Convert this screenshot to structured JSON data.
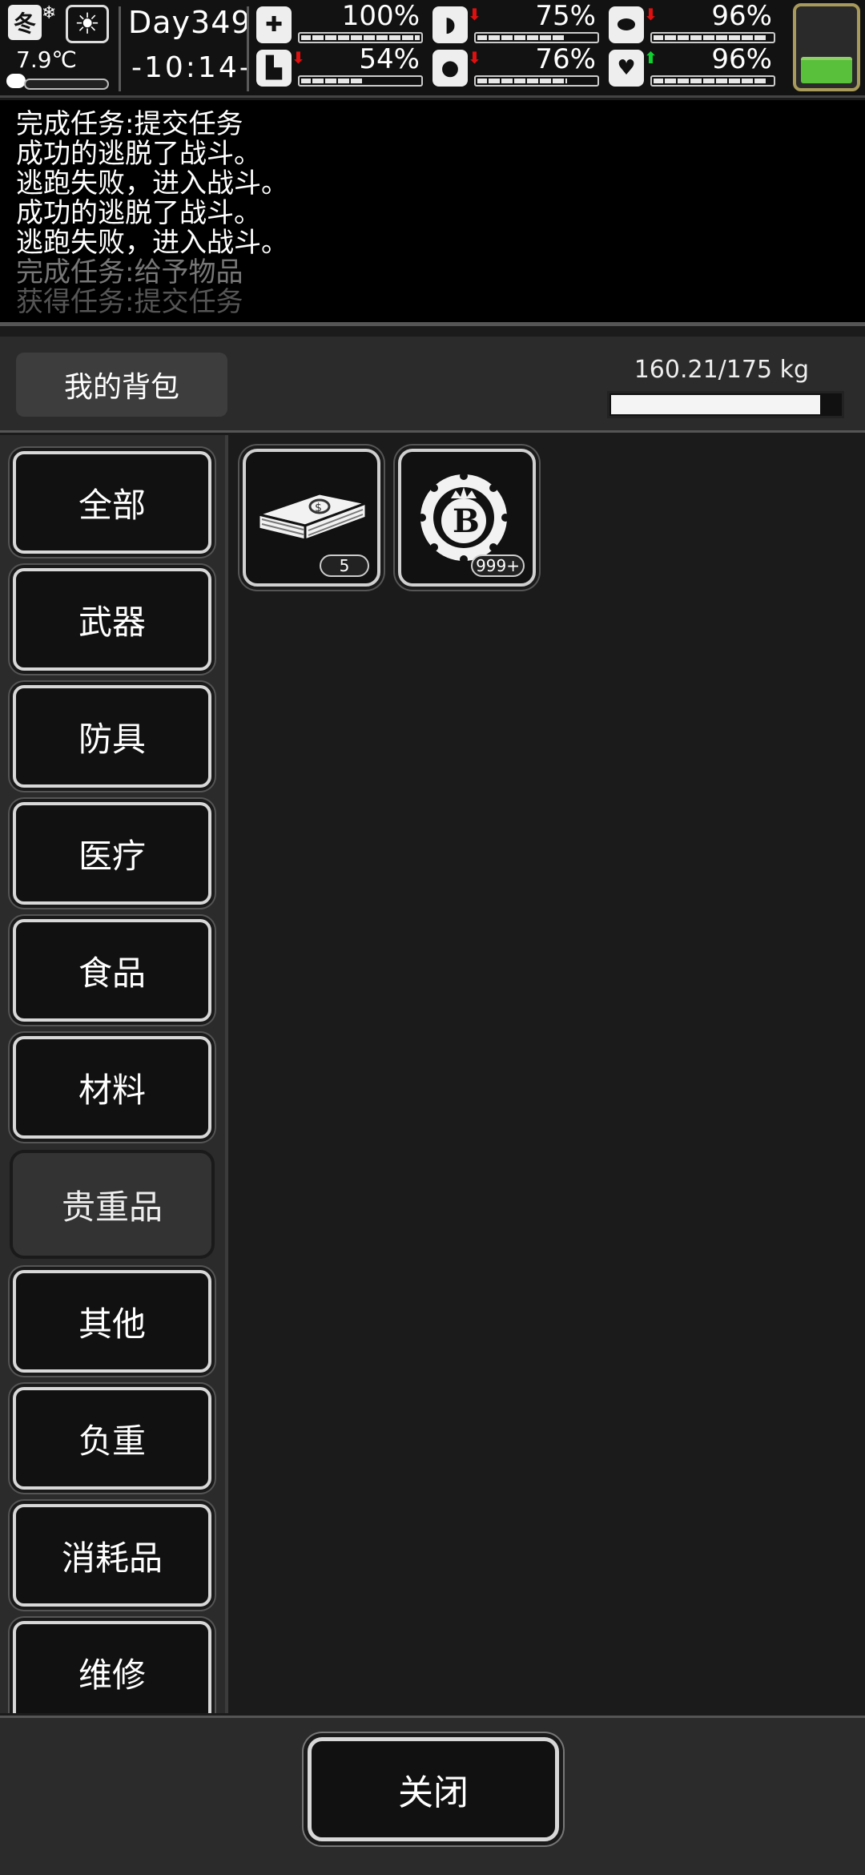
{
  "hud": {
    "season": "冬",
    "temperature": "7.9℃",
    "day": "Day349",
    "time": "-10:14-",
    "stats": [
      {
        "name": "health",
        "icon": "medkit-icon",
        "value": "100%",
        "level": 1.0,
        "trend": ""
      },
      {
        "name": "hunger",
        "icon": "stomach-icon",
        "value": "75%",
        "level": 0.75,
        "trend": "down"
      },
      {
        "name": "medicine",
        "icon": "pill-icon",
        "value": "96%",
        "level": 0.96,
        "trend": "down"
      },
      {
        "name": "stamina",
        "icon": "foot-icon",
        "value": "54%",
        "level": 0.54,
        "trend": "down"
      },
      {
        "name": "thirst",
        "icon": "water-drop-icon",
        "value": "76%",
        "level": 0.76,
        "trend": "down"
      },
      {
        "name": "mood",
        "icon": "heart-icon",
        "value": "96%",
        "level": 0.96,
        "trend": "up"
      }
    ],
    "energy_level": 0.38
  },
  "log": [
    "完成任务:提交任务",
    "成功的逃脱了战斗。",
    "逃跑失败，进入战斗。",
    "成功的逃脱了战斗。",
    "逃跑失败，进入战斗。",
    "完成任务:给予物品",
    "获得任务:提交任务"
  ],
  "bag": {
    "title": "我的背包",
    "weight": "160.21/175 kg",
    "weight_level": 0.9155
  },
  "categories": [
    {
      "label": "全部",
      "active": false
    },
    {
      "label": "武器",
      "active": false
    },
    {
      "label": "防具",
      "active": false
    },
    {
      "label": "医疗",
      "active": false
    },
    {
      "label": "食品",
      "active": false
    },
    {
      "label": "材料",
      "active": false
    },
    {
      "label": "贵重品",
      "active": true
    },
    {
      "label": "其他",
      "active": false
    },
    {
      "label": "负重",
      "active": false
    },
    {
      "label": "消耗品",
      "active": false
    },
    {
      "label": "维修",
      "active": false
    }
  ],
  "items": [
    {
      "icon": "cash-bundle-icon",
      "count": "5"
    },
    {
      "icon": "bitcoin-coin-icon",
      "count": "999+"
    }
  ],
  "footer": {
    "close_label": "关闭"
  },
  "colors": {
    "arrow_down": "#e01010",
    "arrow_up": "#10d030",
    "energy_green": "#58c03a"
  }
}
